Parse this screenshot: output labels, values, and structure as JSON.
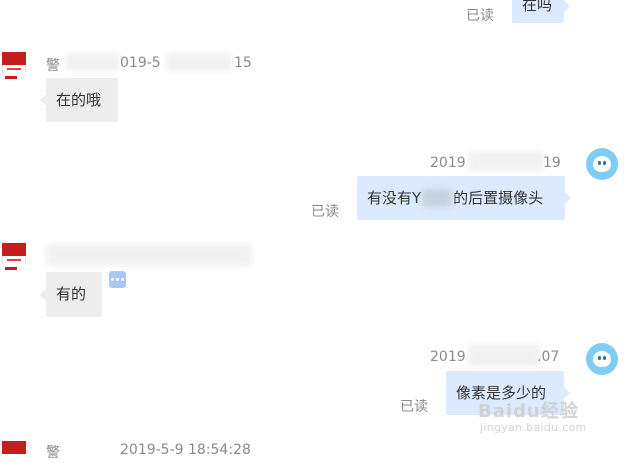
{
  "colors": {
    "left_bubble": "#ededed",
    "right_bubble": "#dbeafe",
    "read_text": "#8a8a8a",
    "user_avatar": "#7fcdf4",
    "shop_avatar": "#c41f1f"
  },
  "messages": [
    {
      "side": "right",
      "text": "在吗",
      "status": "已读"
    },
    {
      "side": "left",
      "sender": "警",
      "timestamp_visible": "019-5",
      "timestamp_tail": "15",
      "text": "在的哦"
    },
    {
      "side": "right",
      "timestamp_prefix": "2019",
      "timestamp_suffix": "19",
      "text_before": "有没有Y",
      "text_after": "的后置摄像头",
      "status": "已读"
    },
    {
      "side": "left",
      "text": "有的",
      "action_icon": "more-icon"
    },
    {
      "side": "right",
      "timestamp_prefix": "2019",
      "timestamp_suffix": ".07",
      "text": "像素是多少的",
      "status": "已读"
    },
    {
      "side": "left",
      "sender_partial": "警",
      "timestamp_partial": "2019-5-9 18:54:28"
    }
  ],
  "watermark": {
    "main": "Baidu经验",
    "sub": "jingyan.baidu.com"
  }
}
